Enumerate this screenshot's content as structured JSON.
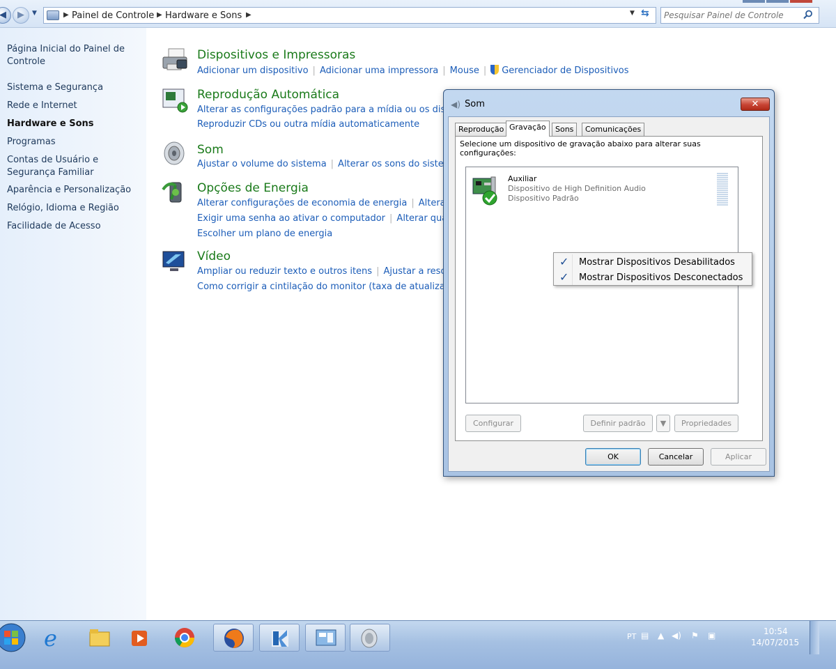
{
  "breadcrumb": {
    "items": [
      "Painel de Controle",
      "Hardware e Sons"
    ]
  },
  "search": {
    "placeholder": "Pesquisar Painel de Controle"
  },
  "sidebar": {
    "items": [
      {
        "label": "Página Inicial do Painel de Controle",
        "bold": false
      },
      {
        "label": "Sistema e Segurança",
        "bold": false
      },
      {
        "label": "Rede e Internet",
        "bold": false
      },
      {
        "label": "Hardware e Sons",
        "bold": true
      },
      {
        "label": "Programas",
        "bold": false
      },
      {
        "label": "Contas de Usuário e Segurança Familiar",
        "bold": false
      },
      {
        "label": "Aparência e Personalização",
        "bold": false
      },
      {
        "label": "Relógio, Idioma e Região",
        "bold": false
      },
      {
        "label": "Facilidade de Acesso",
        "bold": false
      }
    ]
  },
  "categories": [
    {
      "title": "Dispositivos e Impressoras",
      "icon": "printer-icon",
      "link_rows": [
        [
          "Adicionar um dispositivo",
          "Adicionar uma impressora",
          "Mouse",
          "Gerenciador de Dispositivos"
        ]
      ]
    },
    {
      "title": "Reprodução Automática",
      "icon": "autoplay-icon",
      "link_rows": [
        [
          "Alterar as configurações padrão para a mídia ou os dispo"
        ],
        [
          "Reproduzir CDs ou outra mídia automaticamente"
        ]
      ]
    },
    {
      "title": "Som",
      "icon": "speaker-icon",
      "link_rows": [
        [
          "Ajustar o volume do sistema",
          "Alterar os sons do sistem"
        ]
      ]
    },
    {
      "title": "Opções de Energia",
      "icon": "power-icon",
      "link_rows": [
        [
          "Alterar configurações de economia de energia",
          "Alterar"
        ],
        [
          "Exigir uma senha ao ativar o computador",
          "Alterar quar"
        ],
        [
          "Escolher um plano de energia"
        ]
      ]
    },
    {
      "title": "Vídeo",
      "icon": "display-icon",
      "link_rows": [
        [
          "Ampliar ou reduzir texto e outros itens",
          "Ajustar a resolu"
        ],
        [
          "Como corrigir a cintilação do monitor (taxa de atualizaçã"
        ]
      ]
    }
  ],
  "dialog": {
    "title": "Som",
    "close_label": "✕",
    "tabs": [
      "Reprodução",
      "Gravação",
      "Sons",
      "Comunicações"
    ],
    "active_tab": "Gravação",
    "instructions": "Selecione um dispositivo de gravação abaixo para alterar suas configurações:",
    "device": {
      "name": "Auxiliar",
      "driver": "Dispositivo de High Definition Audio",
      "status": "Dispositivo Padrão"
    },
    "buttons": {
      "configure": "Configurar",
      "set_default": "Definir padrão",
      "properties": "Propriedades",
      "ok": "OK",
      "cancel": "Cancelar",
      "apply": "Aplicar"
    }
  },
  "context_menu": {
    "items": [
      {
        "label": "Mostrar Dispositivos Desabilitados",
        "checked": true
      },
      {
        "label": "Mostrar Dispositivos Desconectados",
        "checked": true
      }
    ]
  },
  "taskbar": {
    "apps": [
      "start-orb",
      "internet-explorer",
      "file-explorer",
      "media-player",
      "chrome",
      "firefox",
      "app-k",
      "control-panel",
      "sound"
    ],
    "tray": {
      "language": "PT",
      "time": "10:54",
      "date": "14/07/2015"
    }
  }
}
